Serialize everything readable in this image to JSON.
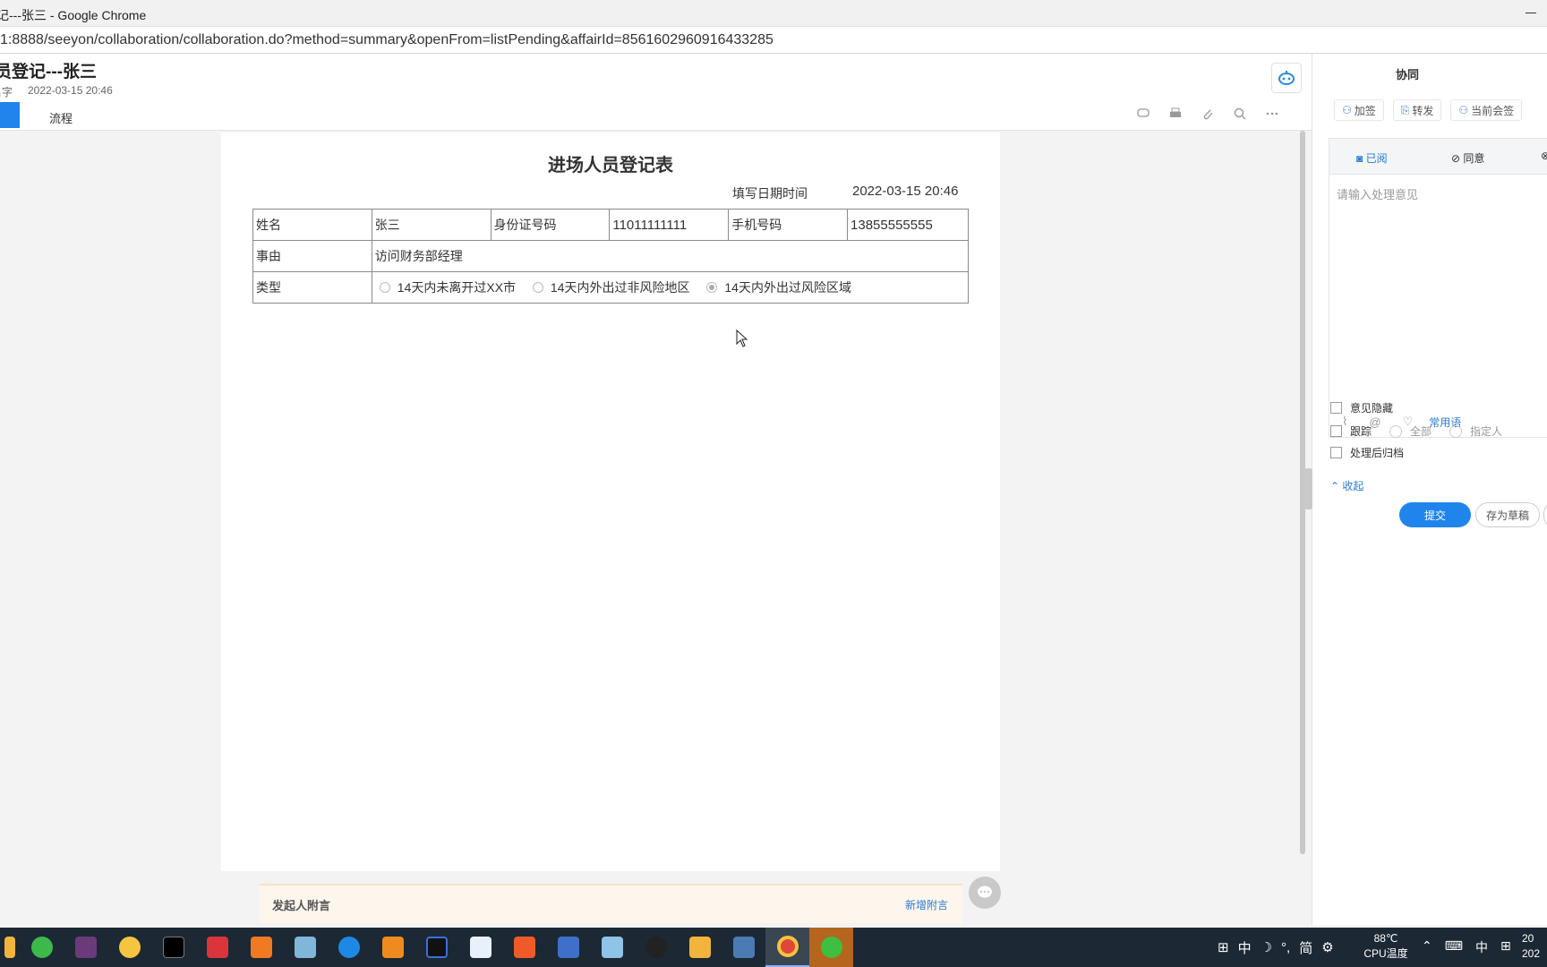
{
  "browser": {
    "window_title": "记---张三 - Google Chrome",
    "url": "1:8888/seeyon/collaboration/collaboration.do?method=summary&openFrom=listPending&affairId=8561602960916433285"
  },
  "header": {
    "doc_title": "员登记---张三",
    "sender": "名字",
    "sent_time": "2022-03-15 20:46",
    "tab_flow": "流程"
  },
  "form": {
    "title": "进场人员登记表",
    "fill_time_label": "填写日期时间",
    "fill_time_value": "2022-03-15 20:46",
    "row1": {
      "name_label": "姓名",
      "name_value": "张三",
      "id_label": "身份证号码",
      "id_value": "11011111111",
      "phone_label": "手机号码",
      "phone_value": "13855555555"
    },
    "row2": {
      "reason_label": "事由",
      "reason_value": "访问财务部经理"
    },
    "row3": {
      "type_label": "类型",
      "options": [
        "14天内未离开过XX市",
        "14天内外出过非风险地区",
        "14天内外出过风险区域"
      ],
      "selected_index": 2
    }
  },
  "notebar": {
    "title": "发起人附言",
    "add_label": "新增附言"
  },
  "right_panel": {
    "title": "协同",
    "actions": [
      "加签",
      "转发",
      "当前会签"
    ],
    "opinion_tabs": [
      "已阅",
      "同意"
    ],
    "opinion_placeholder": "请输入处理意见",
    "common_phrases": "常用语",
    "options": {
      "hide_opinion": "意见隐藏",
      "track": "跟踪",
      "track_all": "全部",
      "track_person": "指定人",
      "archive": "处理后归档"
    },
    "collapse": "收起",
    "submit": "提交",
    "save_draft": "存为草稿"
  },
  "taskbar": {
    "ime": [
      "中",
      "简"
    ],
    "temp_value": "88℃",
    "temp_label": "CPU温度",
    "lang": "中",
    "clock_line1": "20",
    "clock_line2": "202"
  }
}
